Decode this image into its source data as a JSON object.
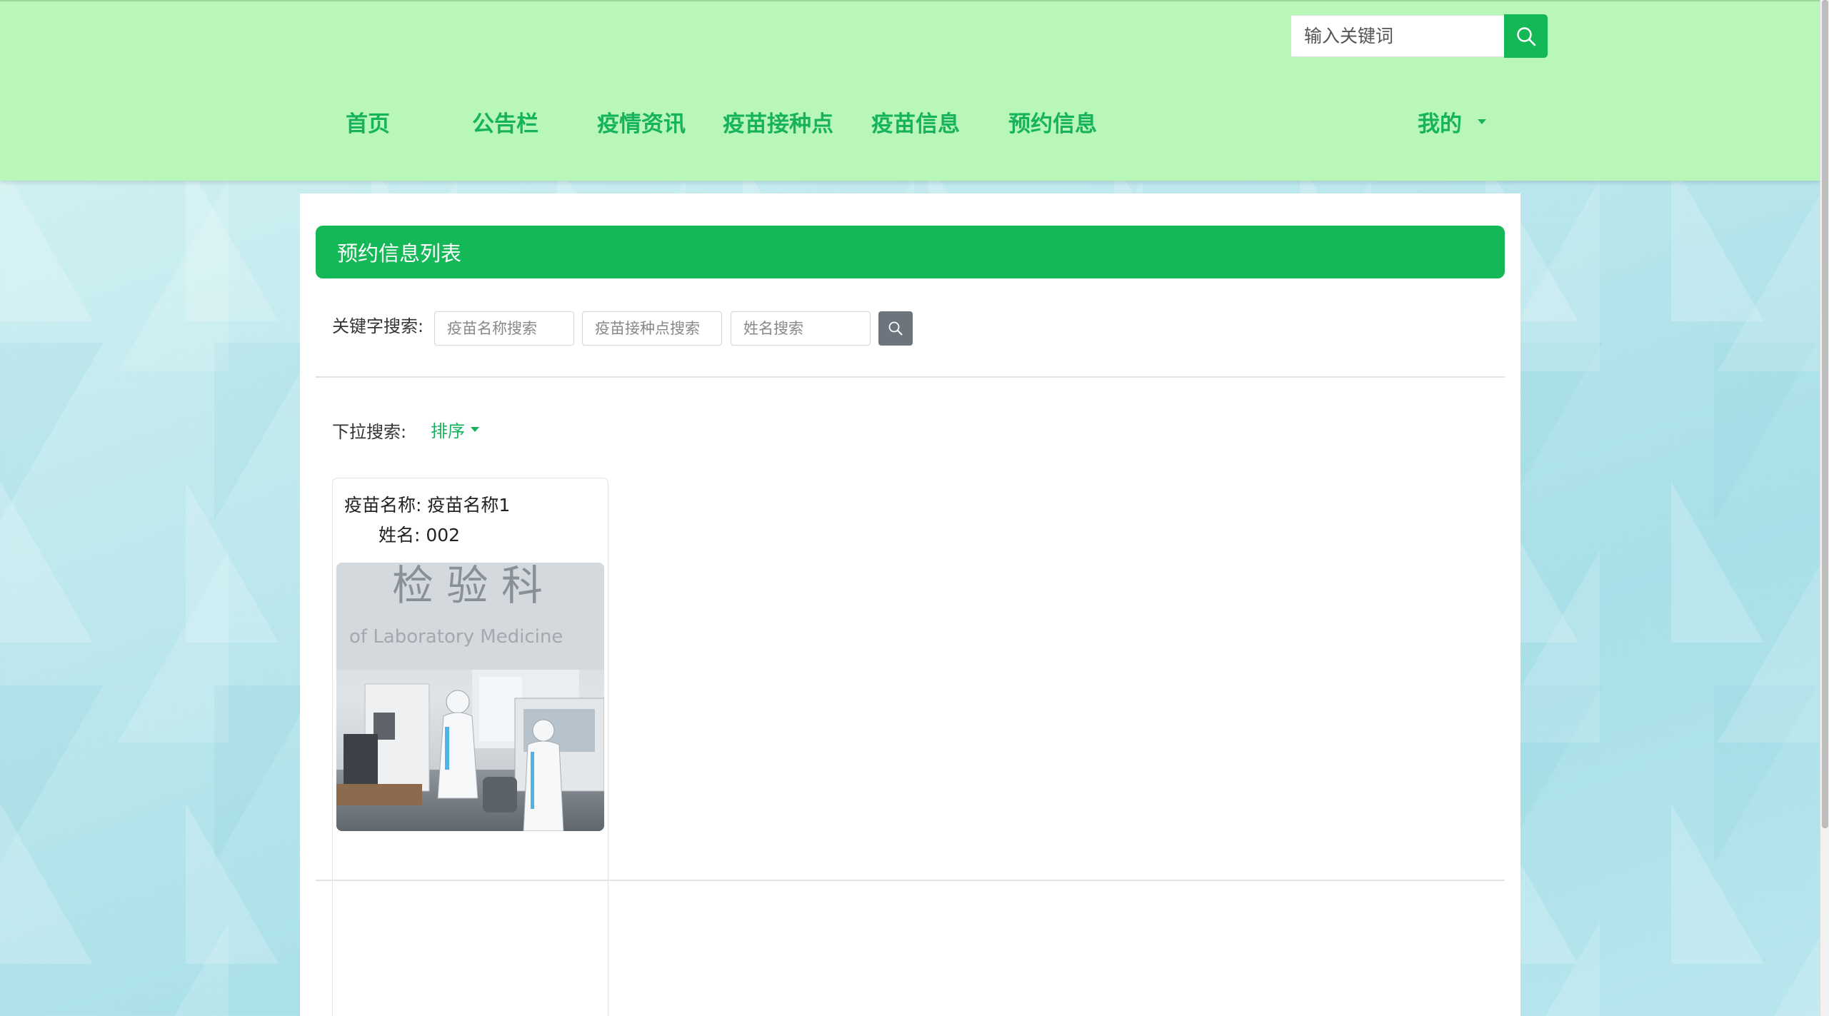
{
  "header": {
    "search_placeholder": "输入关键词",
    "nav": [
      {
        "label": "首页"
      },
      {
        "label": "公告栏"
      },
      {
        "label": "疫情资讯"
      },
      {
        "label": "疫苗接种点"
      },
      {
        "label": "疫苗信息"
      },
      {
        "label": "预约信息"
      }
    ],
    "mine_label": "我的"
  },
  "main": {
    "list_title": "预约信息列表",
    "keyword_label": "关键字搜索:",
    "inputs": [
      {
        "placeholder": "疫苗名称搜索"
      },
      {
        "placeholder": "疫苗接种点搜索"
      },
      {
        "placeholder": "姓名搜索"
      }
    ],
    "dropdown_label": "下拉搜索:",
    "sort_label": "排序",
    "cards": [
      {
        "vaccine_label": "疫苗名称: 疫苗名称1",
        "name_label": "姓名: 002",
        "image_sign_text": "检 验 科",
        "image_sign_subtext": "of Laboratory Medicine"
      }
    ]
  },
  "colors": {
    "header_bg": "#b8f7b8",
    "accent": "#15b856",
    "nav_text": "#17b35c",
    "search_button_gray": "#6c757d"
  }
}
